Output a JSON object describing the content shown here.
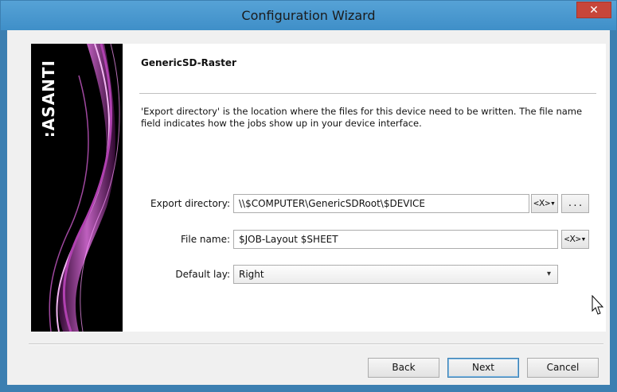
{
  "window": {
    "title": "Configuration Wizard",
    "close_glyph": "✕"
  },
  "brand": {
    "logo_text": ":ASANTI"
  },
  "page": {
    "device_title": "GenericSD-Raster",
    "description": "'Export directory' is the location where the files for this device need to be written. The file name field indicates how the jobs show up in your device interface."
  },
  "form": {
    "export_directory": {
      "label": "Export directory:",
      "value": "\\\\$COMPUTER\\GenericSDRoot\\$DEVICE",
      "variable_button": "<Ⅹ>▾",
      "browse_button": "..."
    },
    "file_name": {
      "label": "File name:",
      "value": "$JOB-Layout $SHEET",
      "variable_button": "<Ⅹ>▾"
    },
    "default_lay": {
      "label": "Default lay:",
      "value": "Right",
      "chevron": "▾"
    }
  },
  "buttons": {
    "back": "Back",
    "next": "Next",
    "cancel": "Cancel"
  },
  "colors": {
    "titlebar": "#56a2d6",
    "close": "#c7463a",
    "brand_bg": "#000000",
    "brand_accent": "#d850d8"
  }
}
